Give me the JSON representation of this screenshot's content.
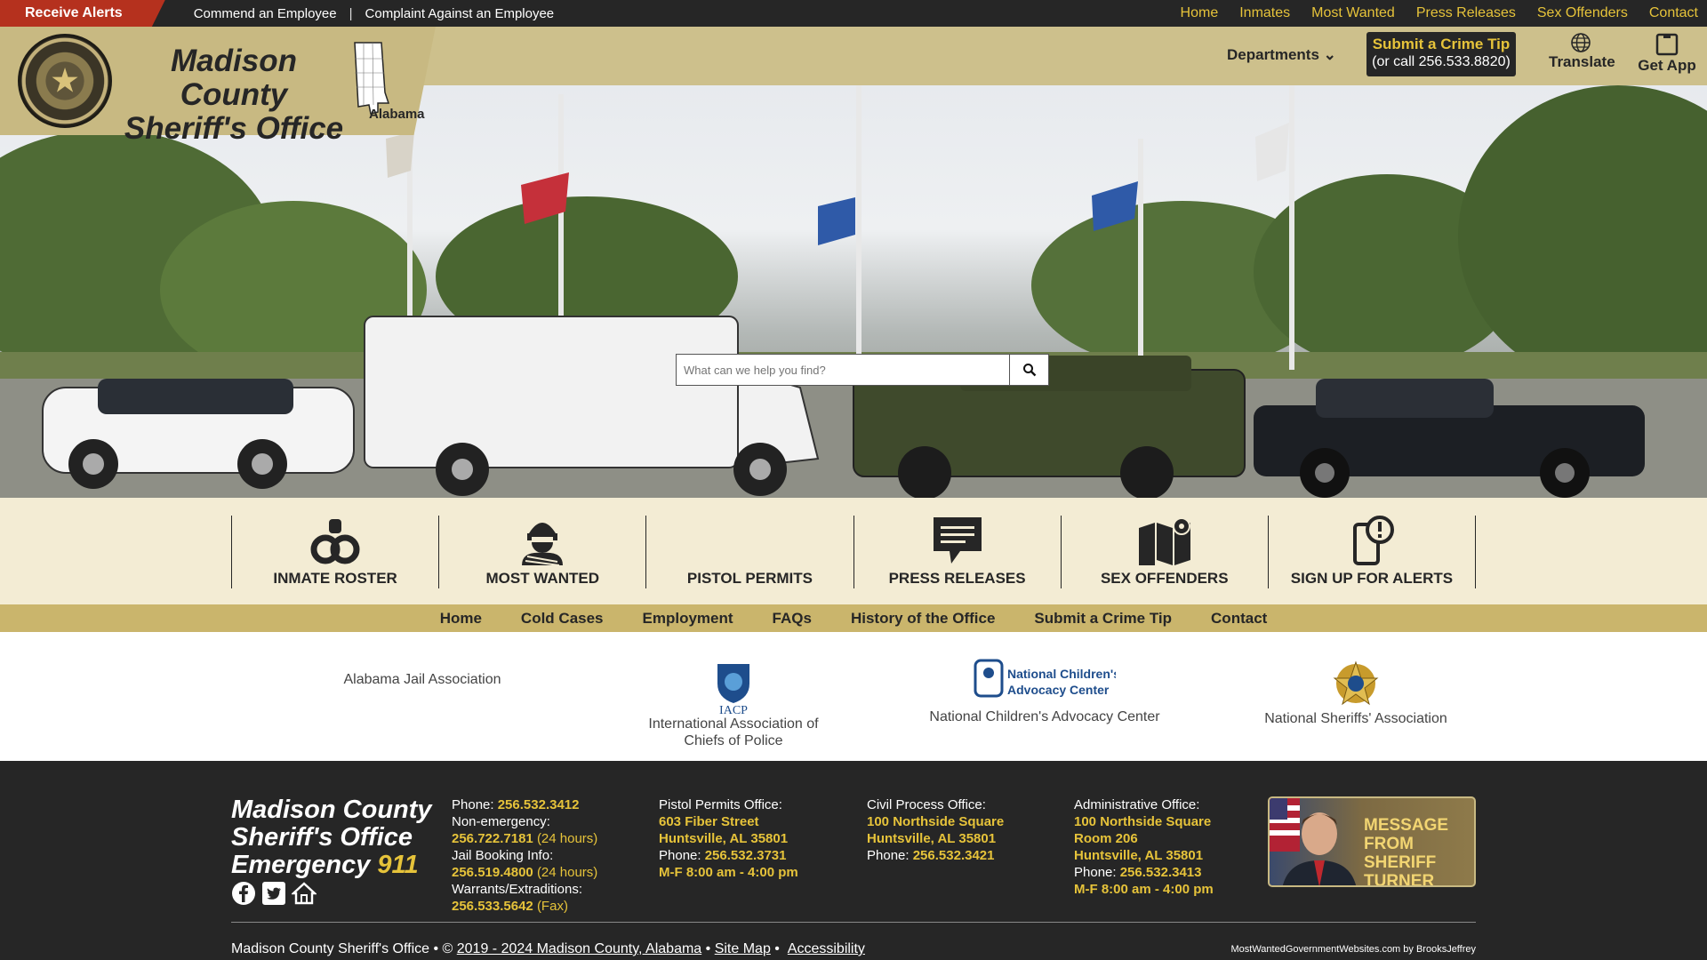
{
  "topbar": {
    "alerts": "Receive Alerts",
    "left_links": [
      "Commend an Employee",
      "Complaint Against an Employee"
    ],
    "separator": "|",
    "right_links": [
      "Home",
      "Inmates",
      "Most Wanted",
      "Press Releases",
      "Sex Offenders",
      "Contact"
    ]
  },
  "header": {
    "title_line1": "Madison County",
    "title_line2": "Sheriff's Office",
    "state": "Alabama",
    "departments": "Departments",
    "crime_tip_title": "Submit a Crime Tip",
    "crime_tip_sub": "(or call 256.533.8820)",
    "translate": "Translate",
    "get_app": "Get App"
  },
  "search": {
    "placeholder": "What can we help you find?"
  },
  "quick_links": [
    {
      "label": "INMATE ROSTER",
      "icon": "handcuffs-icon"
    },
    {
      "label": "MOST WANTED",
      "icon": "bandit-icon"
    },
    {
      "label": "PISTOL PERMITS",
      "icon": "pistol-icon"
    },
    {
      "label": "PRESS RELEASES",
      "icon": "chat-bubble-icon"
    },
    {
      "label": "SEX OFFENDERS",
      "icon": "map-pin-icon"
    },
    {
      "label": "SIGN UP FOR ALERTS",
      "icon": "phone-alert-icon"
    }
  ],
  "subnav": [
    "Home",
    "Cold Cases",
    "Employment",
    "FAQs",
    "History of the Office",
    "Submit a Crime Tip",
    "Contact"
  ],
  "partners": {
    "p1": "Alabama Jail Association",
    "p2_line1": "International Association of",
    "p2_line2": "Chiefs of Police",
    "p2_logo": "IACP",
    "p3": "National Children's Advocacy Center",
    "p3_logo_line1": "National Children's",
    "p3_logo_line2": "Advocacy Center",
    "p4": "National Sheriffs' Association"
  },
  "footer": {
    "brand_line1": "Madison County",
    "brand_line2": "Sheriff's Office",
    "brand_emergency": "Emergency",
    "brand_911": "911",
    "col1": {
      "phone_label": "Phone:",
      "phone": "256.532.3412",
      "nonemergency_label": "Non-emergency:",
      "nonemergency": "256.722.7181",
      "nonemergency_note": "(24 hours)",
      "booking_label": "Jail Booking Info:",
      "booking": "256.519.4800",
      "booking_note": "(24 hours)",
      "warrants_label": "Warrants/Extraditions:",
      "warrants": "256.533.5642",
      "warrants_note": "(Fax)"
    },
    "col2": {
      "title": "Pistol Permits Office:",
      "addr1": "603 Fiber Street",
      "addr2": "Huntsville, AL 35801",
      "phone_label": "Phone:",
      "phone": "256.532.3731",
      "hours": "M-F 8:00 am - 4:00 pm"
    },
    "col3": {
      "title": "Civil Process Office:",
      "addr1": "100 Northside Square",
      "addr2": "Huntsville, AL 35801",
      "phone_label": "Phone:",
      "phone": "256.532.3421"
    },
    "col4": {
      "title": "Administrative Office:",
      "addr1": "100 Northside Square",
      "addr2": "Room 206",
      "addr3": "Huntsville, AL 35801",
      "phone_label": "Phone:",
      "phone": "256.532.3413",
      "hours": "M-F 8:00 am - 4:00 pm"
    },
    "message_line1": "MESSAGE FROM",
    "message_line2": "SHERIFF TURNER",
    "copyright_prefix": "Madison County Sheriff's Office • ©",
    "copyright_link": "2019 - 2024 Madison County, Alabama",
    "sitemap": "Site Map",
    "accessibility": "Accessibility",
    "credit": "MostWantedGovernmentWebsites.com by BrooksJeffrey"
  },
  "colors": {
    "gold": "#e6c33a",
    "dark": "#262626",
    "alert_red": "#b5311e",
    "tan": "#c8b982",
    "cream": "#f3ecd4"
  }
}
